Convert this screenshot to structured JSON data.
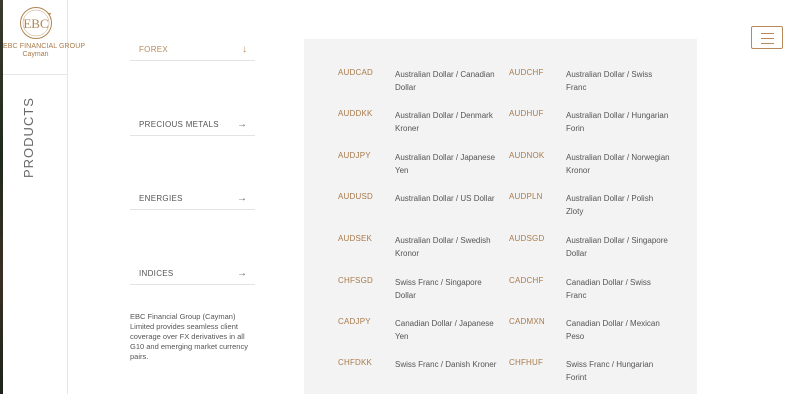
{
  "brand": {
    "logo_text": "EBC",
    "name_line1": "EBC FINANCIAL GROUP",
    "name_line2": "Cayman"
  },
  "side_rail": {
    "label": "PRODUCTS"
  },
  "categories": [
    {
      "label": "FOREX",
      "icon": "arrow-down-icon",
      "glyph": "↓",
      "active": true
    },
    {
      "label": "PRECIOUS METALS",
      "icon": "arrow-right-icon",
      "glyph": "→",
      "active": false
    },
    {
      "label": "ENERGIES",
      "icon": "arrow-right-icon",
      "glyph": "→",
      "active": false
    },
    {
      "label": "INDICES",
      "icon": "arrow-right-icon",
      "glyph": "→",
      "active": false
    }
  ],
  "description": "EBC Financial Group (Cayman) Limited provides seamless client coverage over FX derivatives in all G10 and emerging market currency pairs.",
  "pairs": [
    {
      "code": "AUDCAD",
      "name": "Australian Dollar / Canadian Dollar"
    },
    {
      "code": "AUDCHF",
      "name": "Australian Dollar / Swiss Franc"
    },
    {
      "code": "AUDDKK",
      "name": "Australian Dollar / Denmark Kroner"
    },
    {
      "code": "AUDHUF",
      "name": "Australian Dollar / Hungarian Forin"
    },
    {
      "code": "AUDJPY",
      "name": "Australian Dollar / Japanese Yen"
    },
    {
      "code": "AUDNOK",
      "name": "Australian Dollar / Norwegian Kronor"
    },
    {
      "code": "AUDUSD",
      "name": "Australian Dollar / US Dollar"
    },
    {
      "code": "AUDPLN",
      "name": "Australian Dollar / Polish Zloty"
    },
    {
      "code": "AUDSEK",
      "name": "Australian Dollar / Swedish Kronor"
    },
    {
      "code": "AUDSGD",
      "name": "Australian Dollar / Singapore Dollar"
    },
    {
      "code": "CHFSGD",
      "name": "Swiss Franc / Singapore Dollar"
    },
    {
      "code": "CADCHF",
      "name": "Canadian Dollar / Swiss Franc"
    },
    {
      "code": "CADJPY",
      "name": "Canadian Dollar / Japanese Yen"
    },
    {
      "code": "CADMXN",
      "name": "Canadian Dollar / Mexican Peso"
    },
    {
      "code": "CHFDKK",
      "name": "Swiss Franc / Danish Kroner"
    },
    {
      "code": "CHFHUF",
      "name": "Swiss Franc / Hungarian Forint"
    }
  ],
  "colors": {
    "accent": "#b88a5a",
    "panel_bg": "#f3f3f3"
  },
  "menu": {
    "icon": "hamburger-menu-icon"
  }
}
